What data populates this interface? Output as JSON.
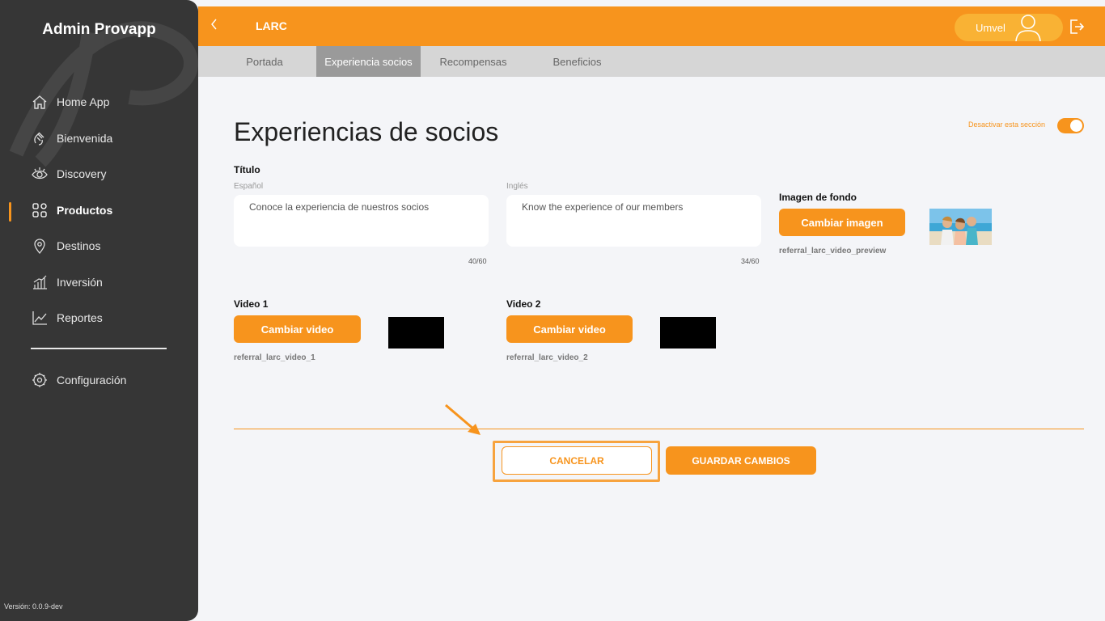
{
  "sidebar": {
    "app_title": "Admin Provapp",
    "items": [
      {
        "label": "Home App",
        "icon": "home-icon"
      },
      {
        "label": "Bienvenida",
        "icon": "wave-hand-icon"
      },
      {
        "label": "Discovery",
        "icon": "eye-icon"
      },
      {
        "label": "Productos",
        "icon": "grid-icon",
        "active": true
      },
      {
        "label": "Destinos",
        "icon": "map-pin-icon"
      },
      {
        "label": "Inversión",
        "icon": "bar-chart-icon"
      },
      {
        "label": "Reportes",
        "icon": "line-chart-icon"
      }
    ],
    "settings_label": "Configuración",
    "version": "Versión: 0.0.9-dev"
  },
  "topbar": {
    "title": "LARC",
    "user_name": "Umvel"
  },
  "tabs": [
    {
      "label": "Portada"
    },
    {
      "label": "Experiencia socios",
      "active": true
    },
    {
      "label": "Recompensas"
    },
    {
      "label": "Beneficios"
    }
  ],
  "main": {
    "page_title": "Experiencias de socios",
    "toggle_label": "Desactivar esta sección",
    "title_label": "Título",
    "spanish": {
      "label": "Español",
      "value": "Conoce la experiencia de nuestros socios",
      "counter": "40/60"
    },
    "english": {
      "label": "Inglés",
      "value": "Know the experience of our members",
      "counter": "34/60"
    },
    "background": {
      "label": "Imagen de fondo",
      "button": "Cambiar imagen",
      "filename": "referral_larc_video_preview"
    },
    "video1": {
      "label": "Video 1",
      "button": "Cambiar video",
      "filename": "referral_larc_video_1"
    },
    "video2": {
      "label": "Video 2",
      "button": "Cambiar video",
      "filename": "referral_larc_video_2"
    },
    "cancel_label": "CANCELAR",
    "save_label": "GUARDAR CAMBIOS"
  },
  "colors": {
    "accent": "#f7941d",
    "sidebar": "#363636",
    "background": "#f4f5f8"
  }
}
